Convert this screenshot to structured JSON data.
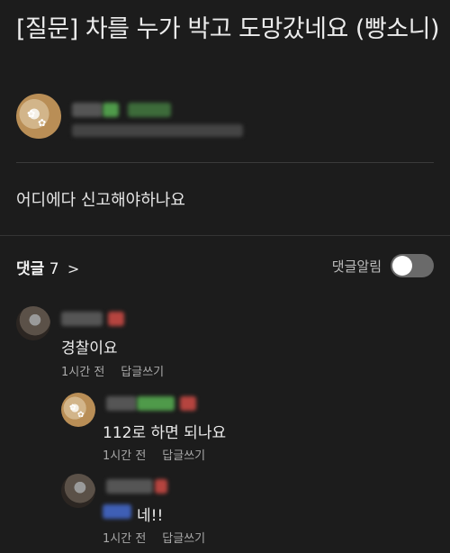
{
  "post": {
    "title": "[질문] 차를 누가 박고 도망갔네요 (빵소니)",
    "body": "어디에다 신고해야하나요"
  },
  "comments_header": {
    "label": "댓글",
    "count": "7",
    "chevron": ">",
    "notify_label": "댓글알림",
    "notify_on": false
  },
  "comments": [
    {
      "text": "경찰이요",
      "time": "1시간 전",
      "reply_label": "답글쓰기"
    },
    {
      "text": "112로 하면 되나요",
      "time": "1시간 전",
      "reply_label": "답글쓰기"
    },
    {
      "text": "네!!",
      "time": "1시간 전",
      "reply_label": "답글쓰기"
    }
  ],
  "icons": {
    "chevron": "chevron-right-icon"
  },
  "colors": {
    "background": "#1c1c1c",
    "text": "#e8e8e8",
    "muted": "#a9a9a9",
    "toggle_off": "#6a6a6a"
  }
}
